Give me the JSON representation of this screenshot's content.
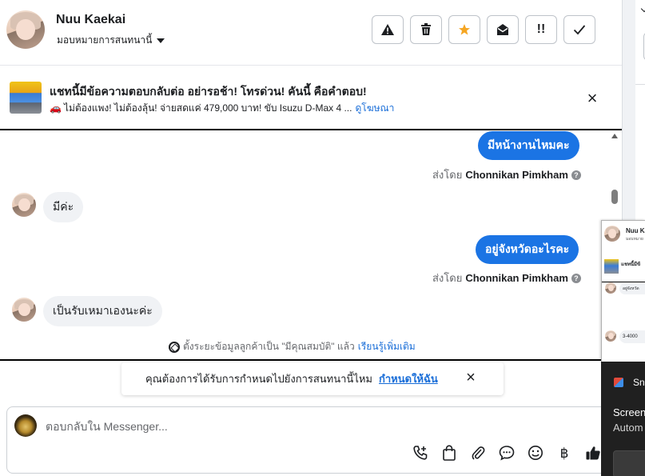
{
  "header": {
    "contact_name": "Nuu Kaekai",
    "assign_label": "มอบหมายการสนทนานี้",
    "toolbar": {
      "warning_icon": "!",
      "trash_icon": "🗑",
      "star_icon": "★",
      "mail_icon": "✉",
      "priority_icon": "!!",
      "check_icon": "✓"
    }
  },
  "ad": {
    "title": "แชทนี้มีข้อความตอบกลับต่อ อย่ารอช้า! โทรด่วน! คันนี้ คือคำตอบ!",
    "description": "ไม่ต้องแพง! ไม่ต้องลุ้น! จ่ายสดแค่ 479,000 บาท! ขับ Isuzu D-Max 4 ...",
    "link": "ดูโฆษณา",
    "close": "×"
  },
  "messages": [
    {
      "direction": "out",
      "text": "มีหน้างานไหมคะ"
    },
    {
      "direction": "sent_by",
      "prefix": "ส่งโดย",
      "name": "Chonnikan Pimkham"
    },
    {
      "direction": "in",
      "text": "มีค่ะ"
    },
    {
      "direction": "out",
      "text": "อยู่จังหวัดอะไรคะ"
    },
    {
      "direction": "sent_by",
      "prefix": "ส่งโดย",
      "name": "Chonnikan Pimkham"
    },
    {
      "direction": "in",
      "text": "เป็นรับเหมาเองนะค่ะ"
    }
  ],
  "notice": {
    "text": "ตั้งระยะข้อมูลลูกค้าเป็น \"มีคุณสมบัติ\" แล้ว",
    "link": "เรียนรู้เพิ่มเติม"
  },
  "prompt": {
    "text": "คุณต้องการได้รับการกำหนดไปยังการสนทนานี้ไหม",
    "link": "กำหนดให้ฉัน",
    "close": "×"
  },
  "composer": {
    "placeholder": "ตอบกลับใน Messenger...",
    "icons": {
      "phone": "✆",
      "bag": "🛍",
      "attach": "📎",
      "chat": "💬",
      "emoji": "☺",
      "baht": "฿",
      "like": "👍"
    }
  },
  "thumbnail": {
    "name": "Nuu Ka",
    "sub": "มอบหมาย",
    "ad_text": "แชทนี้มีข้",
    "bubble1": "อยู่จังหวัด",
    "bubble2": "3-4000"
  },
  "snip": {
    "app": "Sni",
    "title": "Screen",
    "body": "Autom"
  },
  "colors": {
    "accent": "#1b74e4",
    "link": "#1a6ed8",
    "star": "#f5a623"
  }
}
